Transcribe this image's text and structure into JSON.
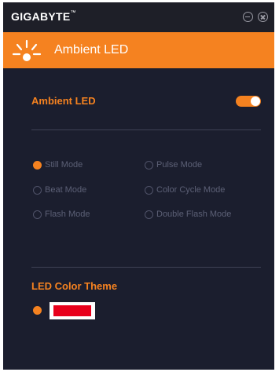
{
  "window": {
    "brand": "GIGABYTE",
    "brand_mark": "™"
  },
  "header": {
    "title": "Ambient LED"
  },
  "ambient": {
    "label": "Ambient LED",
    "enabled": true
  },
  "modes": [
    {
      "label": "Still Mode",
      "selected": true
    },
    {
      "label": "Pulse Mode",
      "selected": false
    },
    {
      "label": "Beat Mode",
      "selected": false
    },
    {
      "label": "Color Cycle Mode",
      "selected": false
    },
    {
      "label": "Flash Mode",
      "selected": false
    },
    {
      "label": "Double Flash Mode",
      "selected": false
    }
  ],
  "color_theme": {
    "label": "LED Color Theme",
    "selected_color": "#e8001c"
  },
  "colors": {
    "accent": "#f58220",
    "background": "#1b1e2e",
    "titlebar": "#1e1f28",
    "text_dim": "#5c6076"
  }
}
